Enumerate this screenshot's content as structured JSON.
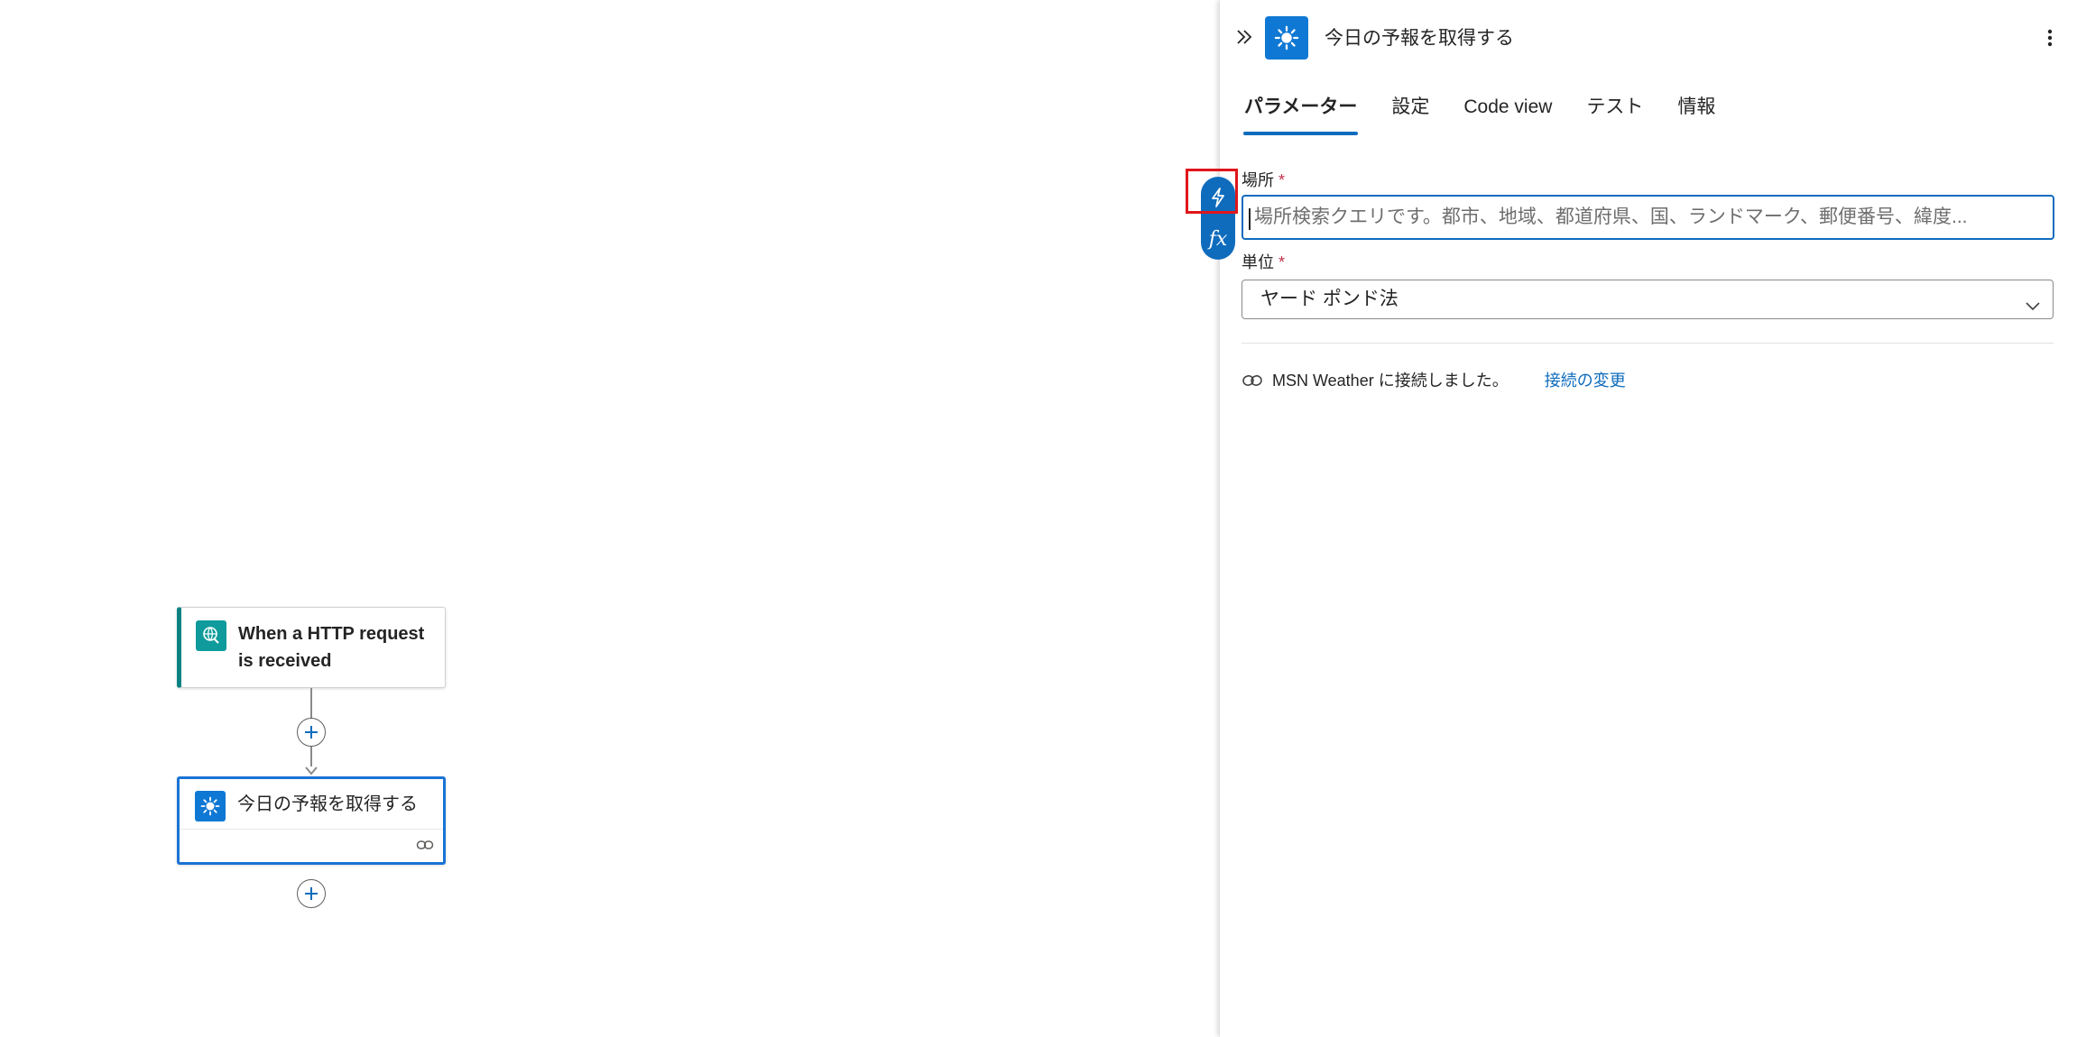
{
  "canvas": {
    "trigger_node": {
      "title": "When a HTTP request is received"
    },
    "weather_node": {
      "title": "今日の予報を取得する"
    }
  },
  "panel": {
    "title": "今日の予報を取得する",
    "tabs": [
      {
        "label": "パラメーター",
        "active": true
      },
      {
        "label": "設定",
        "active": false
      },
      {
        "label": "Code view",
        "active": false
      },
      {
        "label": "テスト",
        "active": false
      },
      {
        "label": "情報",
        "active": false
      }
    ],
    "location": {
      "label": "場所",
      "required_mark": "*",
      "placeholder": "場所検索クエリです。都市、地域、都道府県、国、ランドマーク、郵便番号、緯度..."
    },
    "units": {
      "label": "単位",
      "required_mark": "*",
      "value": "ヤード ポンド法"
    },
    "connection": {
      "text": "MSN Weather に接続しました。",
      "change_link": "接続の変更"
    }
  },
  "colors": {
    "accent": "#0f6cbd",
    "trigger": "#0f9b9b",
    "weather": "#0f78d4",
    "highlight": "#e0161b"
  },
  "icons": {
    "trigger": "http-request-icon",
    "weather": "sun-icon",
    "collapse": "double-chevron-right-icon",
    "more": "more-vertical-icon",
    "dynamic_content": "lightning-icon",
    "expression": "fx-icon",
    "link": "link-icon"
  }
}
